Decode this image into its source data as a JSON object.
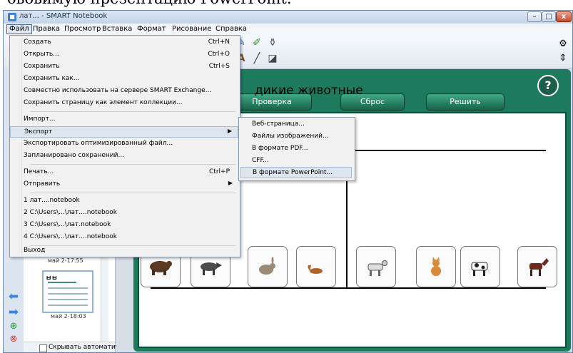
{
  "caption": "ововимую презентацию PowerPoint.",
  "window": {
    "title": "лат... - SMART Notebook",
    "controls": [
      "–",
      "□",
      "x"
    ]
  },
  "menubar": [
    "Файл",
    "Правка",
    "Просмотр",
    "Вставка",
    "Формат",
    "Рисование",
    "Справка"
  ],
  "file_menu": [
    {
      "label": "Создать",
      "shortcut": "Ctrl+N"
    },
    {
      "label": "Открыть...",
      "shortcut": "Ctrl+O"
    },
    {
      "label": "Сохранить",
      "shortcut": "Ctrl+S"
    },
    {
      "label": "Сохранить как...",
      "shortcut": ""
    },
    {
      "label": "Совместно использовать на сервере SMART Exchange...",
      "shortcut": ""
    },
    {
      "label": "Сохранить страницу как элемент коллекции...",
      "shortcut": ""
    },
    {
      "label": "Импорт...",
      "shortcut": ""
    },
    {
      "label": "Экспорт",
      "shortcut": ""
    },
    {
      "label": "Экспортировать оптимизированный файл...",
      "shortcut": ""
    },
    {
      "label": "Запланировано сохранений...",
      "shortcut": ""
    },
    {
      "label": "Печать...",
      "shortcut": "Ctrl+P"
    },
    {
      "label": "Отправить",
      "shortcut": ""
    },
    {
      "label": "1 лат....notebook",
      "shortcut": ""
    },
    {
      "label": "2 C:\\Users\\...\\лат....notebook",
      "shortcut": ""
    },
    {
      "label": "3 C:\\Users\\...\\лат.notebook",
      "shortcut": ""
    },
    {
      "label": "4 C:\\Users\\...\\лат....notebook",
      "shortcut": ""
    },
    {
      "label": "Выход",
      "shortcut": ""
    }
  ],
  "export_submenu": [
    "Веб-страница...",
    "Файлы изображений...",
    "В формате PDF...",
    "CFF...",
    "В формате PowerPoint..."
  ],
  "sorter": {
    "time1": "май 2-17:55",
    "time2": "май 2-18:03",
    "thumb_title": "ㅂㅂ",
    "autohide_label": "Скрывать автоматическ"
  },
  "board": {
    "buttons": [
      "Проверка",
      "Сброс",
      "Решить"
    ],
    "help": "?",
    "heading": "дикие животные",
    "animals": [
      "bear-icon",
      "wolf-icon",
      "rabbit-icon",
      "squirrel-icon",
      "goat-icon",
      "cat-icon",
      "cow-icon",
      "horse-icon"
    ]
  },
  "colors": {
    "board_green": "#1e7a5c",
    "button_green": "#2f8f6d",
    "menu_highlight": "#dde5ef"
  }
}
